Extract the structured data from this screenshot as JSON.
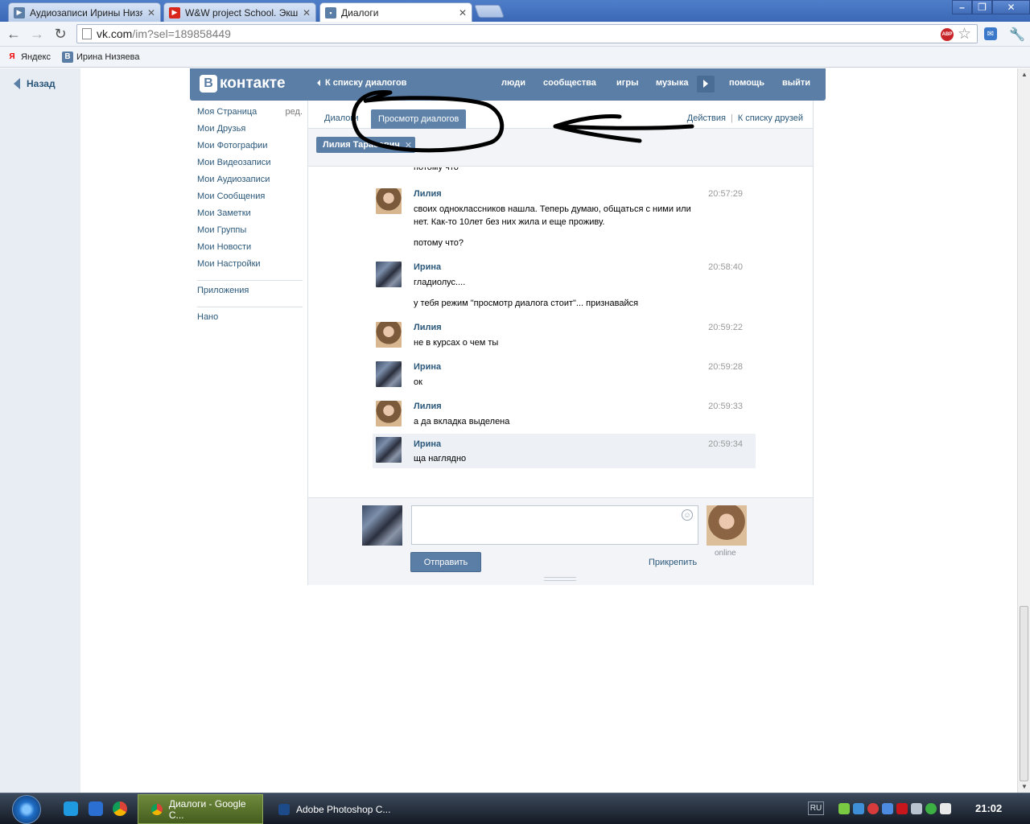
{
  "browser": {
    "tabs": [
      {
        "title": "Аудиозаписи Ирины Низяе",
        "icon": "vk-audio-icon",
        "active": false
      },
      {
        "title": "W&W project School. Экшен",
        "icon": "youtube-icon",
        "active": false
      },
      {
        "title": "Диалоги",
        "icon": "vk-dialogs-icon",
        "active": true
      }
    ],
    "url_host": "vk.com",
    "url_path": "/im?sel=189858449",
    "bookmarks": [
      {
        "label": "Яндекс",
        "icon": "yandex-icon"
      },
      {
        "label": "Ирина Низяева",
        "icon": "vk-icon"
      }
    ],
    "extensions": {
      "abp_label": "ABP"
    }
  },
  "page": {
    "back_label": "Назад",
    "header": {
      "logo_text": "контакте",
      "logo_letter": "В",
      "to_dialogs": "К списку диалогов",
      "links": [
        "люди",
        "сообщества",
        "игры",
        "музыка",
        "помощь",
        "выйти"
      ]
    },
    "left_menu": {
      "items": [
        "Моя Страница",
        "Мои Друзья",
        "Мои Фотографии",
        "Мои Видеозаписи",
        "Мои Аудиозаписи",
        "Мои Сообщения",
        "Мои Заметки",
        "Мои Группы",
        "Мои Новости",
        "Мои Настройки"
      ],
      "edit_label": "ред.",
      "apps": "Приложения",
      "extra": "Нано"
    },
    "tabs": {
      "dialogs": "Диалоги",
      "view": "Просмотр диалогов",
      "actions": "Действия",
      "friends": "К списку друзей"
    },
    "peer_chip": "Лилия Тарасович",
    "partial_text": "потому что",
    "messages": [
      {
        "author": "Лилия",
        "time": "20:57:29",
        "lines": [
          "своих одноклассников нашла. Теперь думаю, общаться с ними или нет. Как-то 10лет без них жила и еще проживу.",
          "потому что?"
        ]
      },
      {
        "author": "Ирина",
        "time": "20:58:40",
        "lines": [
          "гладиолус....",
          "у тебя режим \"просмотр диалога стоит\"... признавайся"
        ]
      },
      {
        "author": "Лилия",
        "time": "20:59:22",
        "lines": [
          "не в курсах о чем ты"
        ]
      },
      {
        "author": "Ирина",
        "time": "20:59:28",
        "lines": [
          "ок"
        ]
      },
      {
        "author": "Лилия",
        "time": "20:59:33",
        "lines": [
          "а да вкладка выделена"
        ]
      },
      {
        "author": "Ирина",
        "time": "20:59:34",
        "lines": [
          "ща наглядно"
        ]
      }
    ],
    "composer": {
      "send_label": "Отправить",
      "attach_label": "Прикрепить",
      "peer_status": "online",
      "smile": "☺"
    }
  },
  "taskbar": {
    "tasks": [
      {
        "label": "Диалоги - Google C...",
        "active": true
      },
      {
        "label": "Adobe Photoshop C...",
        "active": false
      }
    ],
    "language": "RU",
    "clock": "21:02"
  },
  "colors": {
    "vk_blue": "#5b7ea6",
    "vk_link": "#2b587a",
    "annotation": "#000000"
  }
}
